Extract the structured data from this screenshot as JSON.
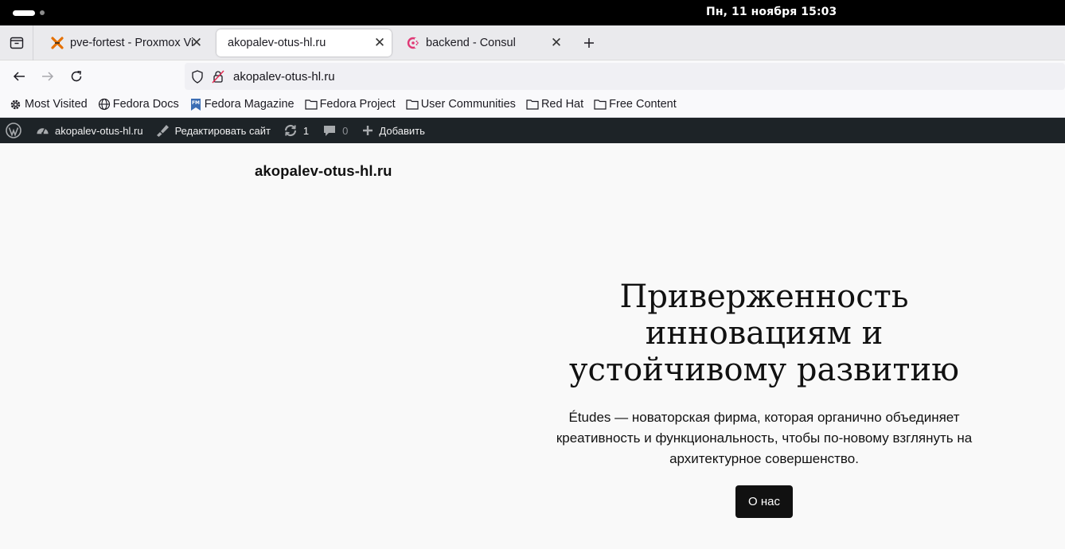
{
  "system": {
    "clock": "Пн, 11 ноября  15:03"
  },
  "browser": {
    "tabs": [
      {
        "title": "pve-fortest - Proxmox Vi",
        "icon": "proxmox-icon",
        "active": false
      },
      {
        "title": "akopalev-otus-hl.ru",
        "icon": "none",
        "active": true
      },
      {
        "title": "backend - Consul",
        "icon": "consul-icon",
        "active": false
      }
    ],
    "close_glyph": "✕",
    "url": "akopalev-otus-hl.ru",
    "bookmarks": [
      {
        "label": "Most Visited",
        "icon": "gear-icon"
      },
      {
        "label": "Fedora Docs",
        "icon": "globe-icon"
      },
      {
        "label": "Fedora Magazine",
        "icon": "fedora-magazine-icon"
      },
      {
        "label": "Fedora Project",
        "icon": "folder-icon"
      },
      {
        "label": "User Communities",
        "icon": "folder-icon"
      },
      {
        "label": "Red Hat",
        "icon": "folder-icon"
      },
      {
        "label": "Free Content",
        "icon": "folder-icon"
      }
    ]
  },
  "wp_admin_bar": {
    "site_name": "akopalev-otus-hl.ru",
    "edit_site": "Редактировать сайт",
    "updates_count": "1",
    "comments_count": "0",
    "add_new": "Добавить"
  },
  "page": {
    "site_title": "akopalev-otus-hl.ru",
    "hero": {
      "heading_lines": [
        "Приверженность",
        "инновациям и",
        "устойчивому развитию"
      ],
      "text": "Études — новаторская фирма, которая органично объединяет креативность и функциональность, чтобы по-новому взглянуть на архитектурное совершенство.",
      "button": "О нас"
    }
  },
  "colors": {
    "topbar": "#000000",
    "wp_admin_bar": "#1d2327",
    "page_bg": "#f9f9f9",
    "button_bg": "#111111"
  }
}
